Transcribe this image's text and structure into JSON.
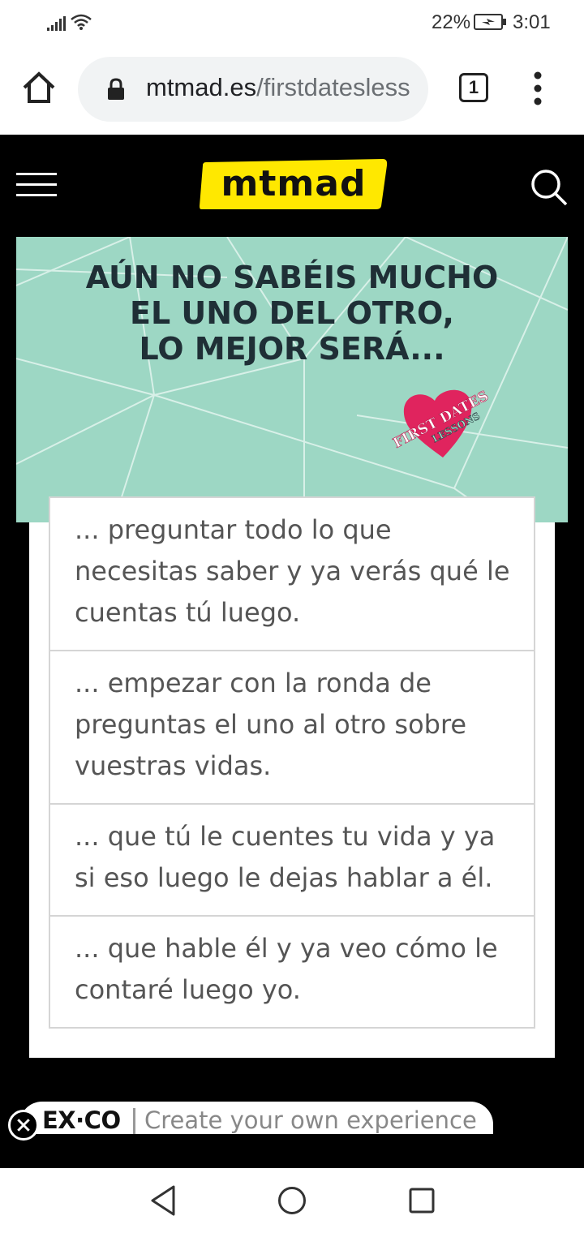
{
  "status_bar": {
    "battery_percent": "22%",
    "time": "3:01",
    "icons": [
      "signal-icon",
      "wifi-icon",
      "battery-charging-icon"
    ]
  },
  "browser": {
    "url_host": "mtmad.es",
    "url_path": "/firstdatesless",
    "tab_count": "1",
    "icons": [
      "home-icon",
      "lock-icon",
      "more-vert-icon"
    ]
  },
  "site_header": {
    "logo_text": "mtmad",
    "logo_color": "#ffe800",
    "icons": [
      "hamburger-menu-icon",
      "search-icon"
    ]
  },
  "banner": {
    "title_lines": [
      "AÚN NO SABÉIS MUCHO",
      "EL UNO DEL OTRO,",
      "LO MEJOR SERÁ..."
    ],
    "badge_line1": "FIRST DATES",
    "badge_line2": "LESSONS",
    "background_color": "#9dd7c4"
  },
  "options": [
    {
      "text": "... preguntar todo lo que necesitas saber y ya verás qué le cuentas tú luego."
    },
    {
      "text": "... empezar con la ronda de preguntas el uno al otro sobre vuestras vidas."
    },
    {
      "text": "... que tú le cuentes tu vida y ya si eso luego le dejas hablar a él."
    },
    {
      "text": "... que hable él y ya veo cómo le contaré luego yo."
    }
  ],
  "exco": {
    "brand": "EX·CO",
    "tagline": "Create your own experience"
  },
  "navbar": {
    "icons": [
      "back-icon",
      "home-circle-icon",
      "recents-icon"
    ]
  }
}
